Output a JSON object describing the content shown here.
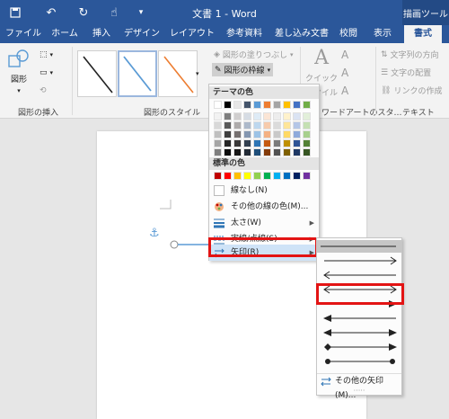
{
  "titlebar": {
    "title": "文書 1 - Word",
    "tool_label": "描画ツール",
    "quick_access": [
      "save-icon",
      "undo-icon",
      "redo-icon",
      "touch-mode-icon",
      "customize-icon"
    ]
  },
  "tabs": [
    "ファイル",
    "ホーム",
    "挿入",
    "デザイン",
    "レイアウト",
    "参考資料",
    "差し込み文書",
    "校閲",
    "表示",
    "書式"
  ],
  "active_tab": "書式",
  "ribbon": {
    "insert_shapes": {
      "shapes_label": "図形",
      "group_label": "図形の挿入"
    },
    "shape_styles": {
      "group_label": "図形のスタイル",
      "fill_label": "図形の塗りつぶし",
      "outline_label": "図形の枠線"
    },
    "wordart": {
      "quick_label": "クイック",
      "style_label": "スタイル",
      "group_label": "ワードアートのスタ…"
    },
    "text": {
      "direction_label": "文字列の方向",
      "align_label": "文字の配置",
      "link_label": "リンクの作成",
      "group_label": "テキスト"
    }
  },
  "outline_menu": {
    "theme_header": "テーマの色",
    "standard_header": "標準の色",
    "no_outline": "線なし(N)",
    "more_colors": "その他の線の色(M)...",
    "weight": "太さ(W)",
    "dashes": "実線/点線(S)",
    "arrows": "矢印(R)",
    "theme_colors": [
      [
        "#ffffff",
        "#000000",
        "#e7e6e6",
        "#44546a",
        "#5b9bd5",
        "#ed7d31",
        "#a5a5a5",
        "#ffc000",
        "#4472c4",
        "#70ad47"
      ],
      [
        "#f2f2f2",
        "#7f7f7f",
        "#d0cece",
        "#d6dce4",
        "#deebf6",
        "#fbe5d5",
        "#ededed",
        "#fff2cc",
        "#dae3f3",
        "#e2efd9"
      ],
      [
        "#d8d8d8",
        "#595959",
        "#aeabab",
        "#adb9ca",
        "#bdd7ee",
        "#f7cbac",
        "#dbdbdb",
        "#fee599",
        "#b4c6e7",
        "#c5e0b3"
      ],
      [
        "#bfbfbf",
        "#3f3f3f",
        "#757070",
        "#8496b0",
        "#9dc3e6",
        "#f4b183",
        "#c9c9c9",
        "#ffd966",
        "#8eaadb",
        "#a8d08d"
      ],
      [
        "#a5a5a5",
        "#262626",
        "#3a3838",
        "#323f4f",
        "#2e75b5",
        "#c55a11",
        "#7b7b7b",
        "#bf9000",
        "#2f5496",
        "#538135"
      ],
      [
        "#7f7f7f",
        "#0c0c0c",
        "#171616",
        "#222a35",
        "#1e4e79",
        "#843c0b",
        "#525252",
        "#7f6000",
        "#1f3864",
        "#375623"
      ]
    ],
    "standard_colors": [
      "#c00000",
      "#ff0000",
      "#ffc000",
      "#ffff00",
      "#92d050",
      "#00b050",
      "#00b0f0",
      "#0070c0",
      "#002060",
      "#7030a0"
    ]
  },
  "arrows_submenu": {
    "more_arrows": "その他の矢印(M)..."
  }
}
